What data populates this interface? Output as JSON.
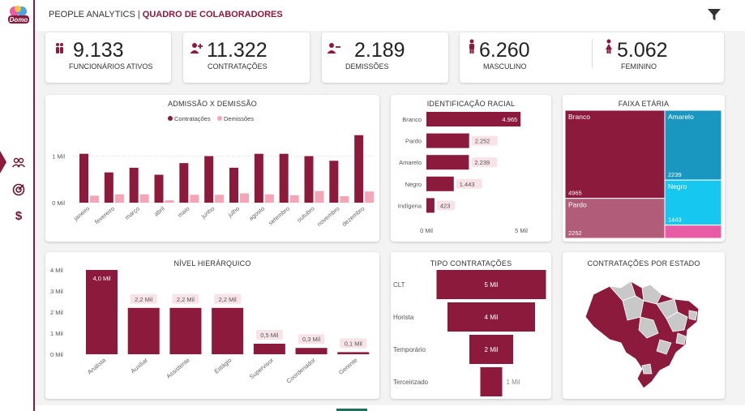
{
  "header": {
    "title_prefix": "PEOPLE ANALYTICS | ",
    "title_main": "QUADRO DE COLABORADORES",
    "logo_text": "Domo"
  },
  "kpis": [
    {
      "icon": "group-icon",
      "value": "9.133",
      "label": "FUNCIONÁRIOS ATIVOS"
    },
    {
      "icon": "user-add-icon",
      "value": "11.322",
      "label": "CONTRATAÇÕES"
    },
    {
      "icon": "user-remove-icon",
      "value": "2.189",
      "label": "DEMISSÕES"
    },
    {
      "icon": "male-icon",
      "value": "6.260",
      "label": "MASCULINO"
    },
    {
      "icon": "female-icon",
      "value": "5.062",
      "label": "FEMININO"
    }
  ],
  "colors": {
    "primary": "#8b1a3d",
    "secondary": "#f4a6b6",
    "light_primary": "#b15c78",
    "teal": "#1a97c0",
    "cyan": "#16c7f0",
    "pink": "#e85ca6"
  },
  "chart_data": [
    {
      "id": "admissao",
      "type": "bar",
      "title": "ADMISSÃO X DEMISSÃO",
      "categories": [
        "janeiro",
        "fevereiro",
        "março",
        "abril",
        "maio",
        "junho",
        "julho",
        "agosto",
        "setembro",
        "outubro",
        "novembro",
        "dezembro"
      ],
      "series": [
        {
          "name": "Contratações",
          "values": [
            1.05,
            0.65,
            0.75,
            0.6,
            0.85,
            1.0,
            0.75,
            1.05,
            1.05,
            1.0,
            0.9,
            1.45
          ]
        },
        {
          "name": "Demissões",
          "values": [
            0.15,
            0.18,
            0.18,
            0.05,
            0.17,
            0.17,
            0.2,
            0.18,
            0.16,
            0.25,
            0.14,
            0.24
          ]
        }
      ],
      "ytick_labels": [
        "0 Mil",
        "1 Mil"
      ],
      "yticks": [
        0,
        1
      ],
      "ylim": [
        0,
        1.55
      ],
      "legend": "top"
    },
    {
      "id": "racial",
      "type": "bar",
      "orientation": "horizontal",
      "title": "IDENTIFICAÇÃO RACIAL",
      "categories": [
        "Branco",
        "Pardo",
        "Amarelo",
        "Negro",
        "Indígena"
      ],
      "values": [
        4965,
        2252,
        2239,
        1443,
        423
      ],
      "labels": [
        "4.965",
        "2.252",
        "2.239",
        "1.443",
        "423"
      ],
      "xtick_labels": [
        "0 Mil",
        "5 Mil"
      ],
      "xticks": [
        0,
        5000
      ],
      "xlim": [
        0,
        5000
      ]
    },
    {
      "id": "faixa",
      "type": "treemap",
      "title": "FAIXA ETÁRIA",
      "items": [
        {
          "label": "Branco",
          "value": 4965,
          "value_label": "4965",
          "color": "#8b1a3d"
        },
        {
          "label": "Pardo",
          "value": 2252,
          "value_label": "2252",
          "color": "#b15c78"
        },
        {
          "label": "Amarelo",
          "value": 2239,
          "value_label": "2239",
          "color": "#1a97c0"
        },
        {
          "label": "Negro",
          "value": 1443,
          "value_label": "1443",
          "color": "#16c7f0"
        },
        {
          "label": "",
          "value": 423,
          "value_label": "",
          "color": "#e85ca6"
        }
      ]
    },
    {
      "id": "nivel",
      "type": "bar",
      "title": "NÍVEL HIERÁRQUICO",
      "categories": [
        "Analista",
        "Auxiliar",
        "Assistente",
        "Estágio",
        "Supervisor",
        "Coordenador",
        "Gerente"
      ],
      "values": [
        4.0,
        2.2,
        2.2,
        2.2,
        0.5,
        0.3,
        0.1
      ],
      "labels": [
        "4,0 Mil",
        "2,2 Mil",
        "2,2 Mil",
        "2,2 Mil",
        "0,5 Mil",
        "0,3 Mil",
        "0,1 Mil"
      ],
      "ytick_labels": [
        "0 Mil",
        "1 Mil",
        "2 Mil",
        "3 Mil",
        "4 Mil"
      ],
      "yticks": [
        0,
        1,
        2,
        3,
        4
      ],
      "ylim": [
        0,
        4
      ]
    },
    {
      "id": "tipo",
      "type": "bar",
      "orientation": "funnel",
      "title": "TIPO CONTRATAÇÕES",
      "categories": [
        "CLT",
        "Horista",
        "Temporário",
        "Terceirizado"
      ],
      "values": [
        5,
        4,
        2,
        1
      ],
      "labels": [
        "5 Mil",
        "4 Mil",
        "2 Mil",
        "1 Mil"
      ]
    }
  ],
  "map": {
    "title": "CONTRATAÇÕES POR ESTADO"
  }
}
